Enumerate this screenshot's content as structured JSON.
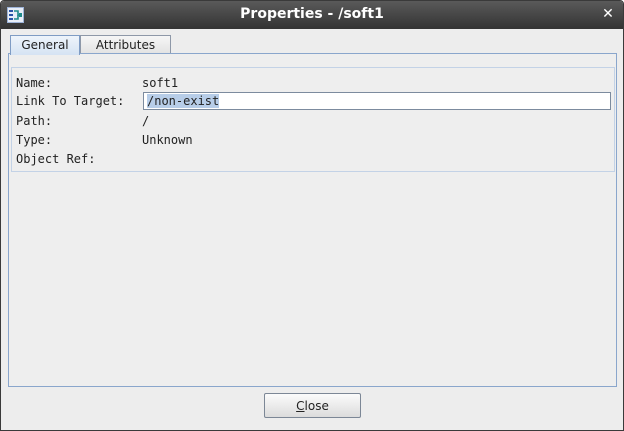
{
  "window": {
    "title": "Properties - /soft1",
    "app_icon": "hdfview-icon",
    "close_glyph": "✕"
  },
  "tabs": [
    {
      "label": "General",
      "active": true
    },
    {
      "label": "Attributes",
      "active": false
    }
  ],
  "general": {
    "fields": {
      "name": {
        "label": "Name:",
        "value": "soft1"
      },
      "link_to_target": {
        "label": "Link To Target:",
        "value": "/non-exist"
      },
      "path": {
        "label": "Path:",
        "value": "/"
      },
      "type": {
        "label": "Type:",
        "value": "Unknown"
      },
      "object_ref": {
        "label": "Object Ref:",
        "value": ""
      }
    }
  },
  "footer": {
    "close_mnemonic": "C",
    "close_rest": "lose"
  }
}
